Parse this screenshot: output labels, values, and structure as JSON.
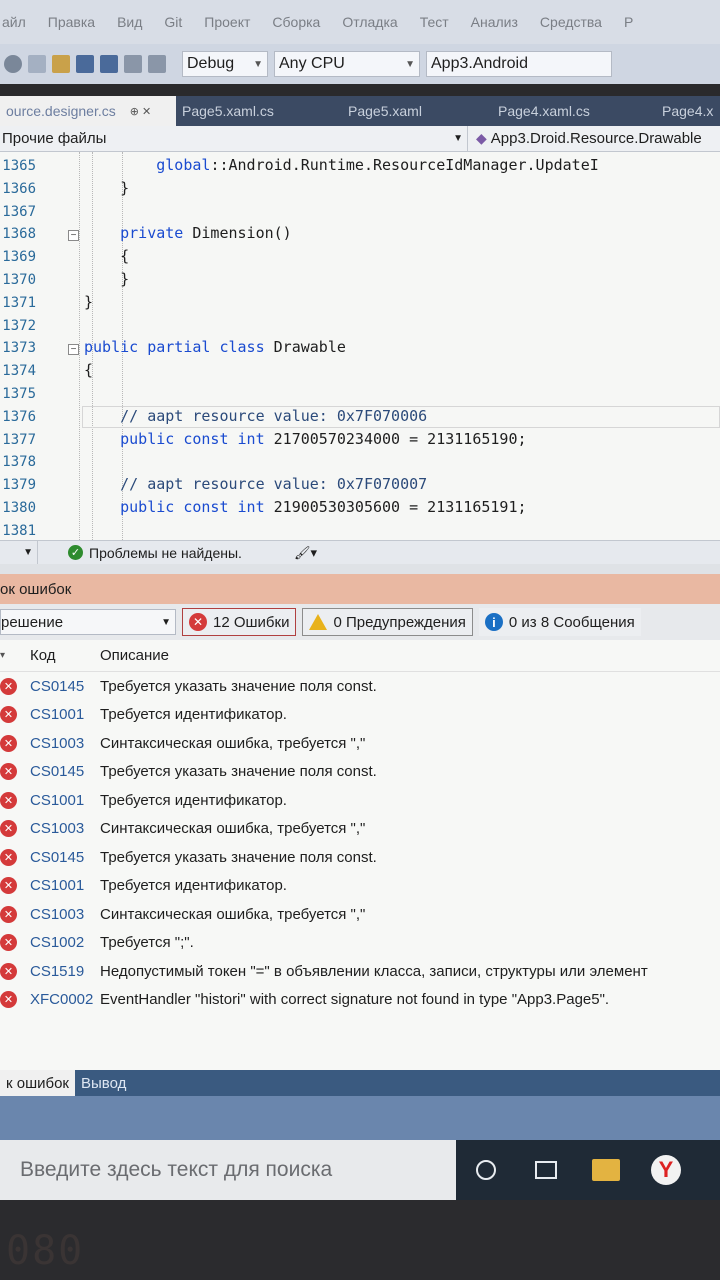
{
  "menu": [
    "айл",
    "Правка",
    "Вид",
    "Git",
    "Проект",
    "Сборка",
    "Отладка",
    "Тест",
    "Анализ",
    "Средства",
    "Р"
  ],
  "toolbar": {
    "configuration": "Debug",
    "platform": "Any CPU",
    "startup_project": "App3.Android"
  },
  "tabs": [
    {
      "label": "ource.designer.cs",
      "active": true
    },
    {
      "label": "Page5.xaml.cs",
      "active": false
    },
    {
      "label": "Page5.xaml",
      "active": false
    },
    {
      "label": "Page4.xaml.cs",
      "active": false
    },
    {
      "label": "Page4.x",
      "active": false
    }
  ],
  "navbar": {
    "project": "Прочие файлы",
    "member": "App3.Droid.Resource.Drawable"
  },
  "code_lines": [
    {
      "num": "1365",
      "text": "        global::Android.Runtime.ResourceIdManager.UpdateI"
    },
    {
      "num": "1366",
      "text": "    }"
    },
    {
      "num": "1367",
      "text": ""
    },
    {
      "num": "1368",
      "text": "    private Dimension()"
    },
    {
      "num": "1369",
      "text": "    {"
    },
    {
      "num": "1370",
      "text": "    }"
    },
    {
      "num": "1371",
      "text": "}"
    },
    {
      "num": "1372",
      "text": ""
    },
    {
      "num": "1373",
      "text": "public partial class Drawable"
    },
    {
      "num": "1374",
      "text": "{"
    },
    {
      "num": "1375",
      "text": ""
    },
    {
      "num": "1376",
      "text": "    // aapt resource value: 0x7F070006"
    },
    {
      "num": "1377",
      "text": "    public const int 21700570234000 = 2131165190;"
    },
    {
      "num": "1378",
      "text": ""
    },
    {
      "num": "1379",
      "text": "    // aapt resource value: 0x7F070007"
    },
    {
      "num": "1380",
      "text": "    public const int 21900530305600 = 2131165191;"
    },
    {
      "num": "1381",
      "text": ""
    }
  ],
  "editor_status": {
    "message": "Проблемы не найдены."
  },
  "error_panel": {
    "title": "ок ошибок",
    "scope": "решение",
    "errors_filter": "12 Ошибки",
    "warnings_filter": "0 Предупреждения",
    "messages_filter": "0 из 8 Сообщения",
    "col_code": "Код",
    "col_description": "Описание",
    "rows": [
      {
        "code": "CS0145",
        "description": "Требуется указать значение поля const."
      },
      {
        "code": "CS1001",
        "description": "Требуется идентификатор."
      },
      {
        "code": "CS1003",
        "description": "Синтаксическая ошибка, требуется \",\""
      },
      {
        "code": "CS0145",
        "description": "Требуется указать значение поля const."
      },
      {
        "code": "CS1001",
        "description": "Требуется идентификатор."
      },
      {
        "code": "CS1003",
        "description": "Синтаксическая ошибка, требуется \",\""
      },
      {
        "code": "CS0145",
        "description": "Требуется указать значение поля const."
      },
      {
        "code": "CS1001",
        "description": "Требуется идентификатор."
      },
      {
        "code": "CS1003",
        "description": "Синтаксическая ошибка, требуется \",\""
      },
      {
        "code": "CS1002",
        "description": "Требуется \";\"."
      },
      {
        "code": "CS1519",
        "description": "Недопустимый токен \"=\" в объявлении класса, записи, структуры или элемент"
      },
      {
        "code": "XFC0002",
        "description": "EventHandler \"histori\" with correct signature not found in type \"App3.Page5\"."
      }
    ],
    "bottom_tabs": [
      "к ошибок",
      "Вывод"
    ]
  },
  "taskbar": {
    "search_placeholder": "Введите здесь текст для поиска"
  },
  "bezel_text": "080"
}
